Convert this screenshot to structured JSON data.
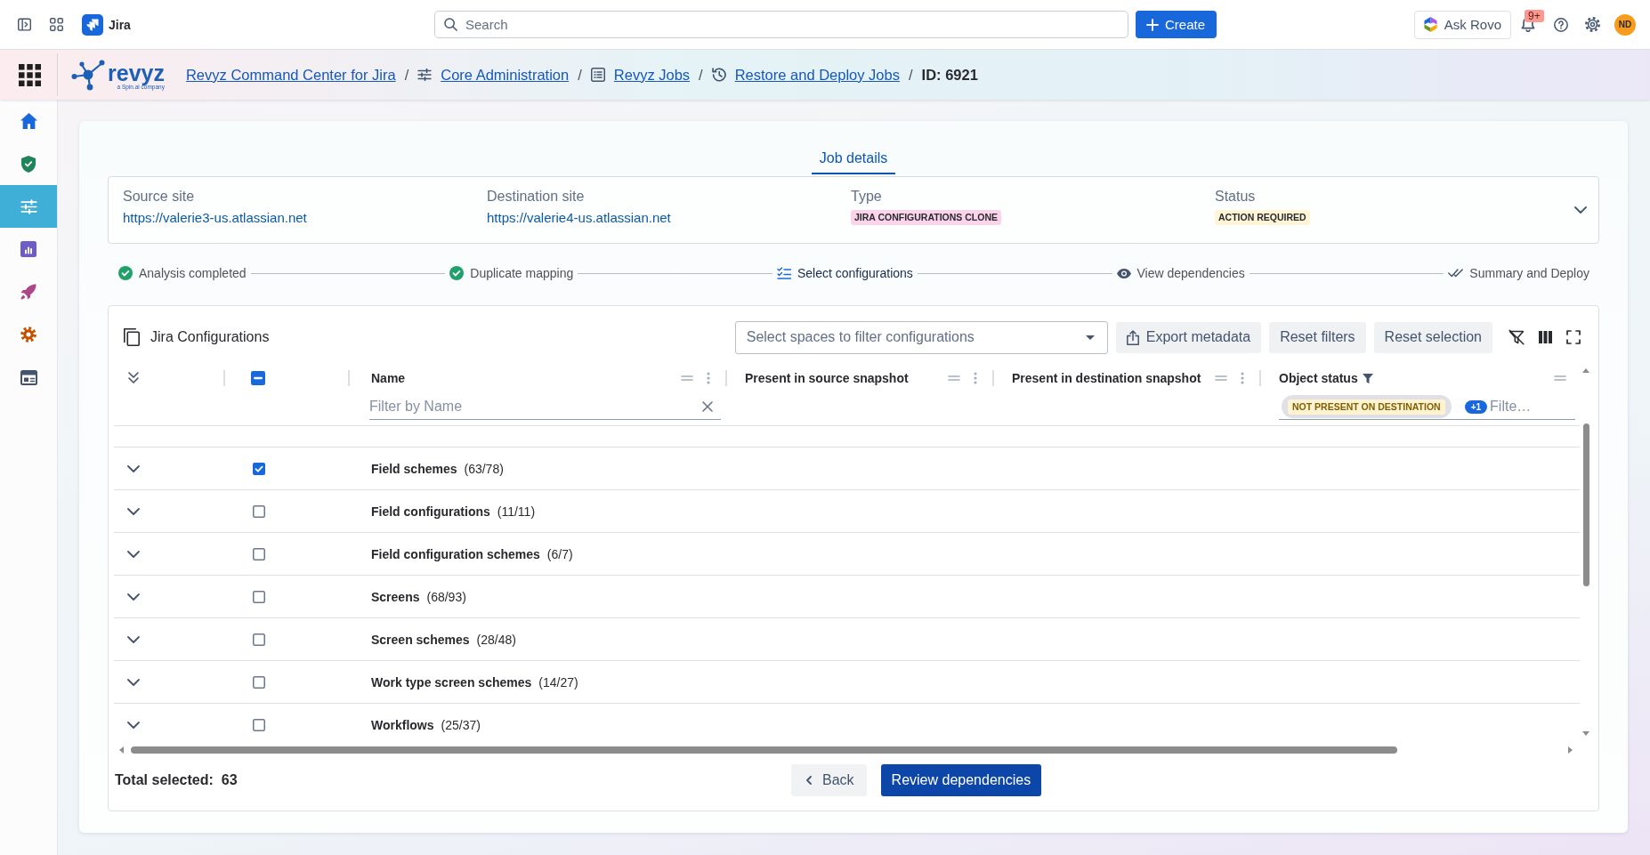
{
  "top_bar": {
    "product": "Jira",
    "search": {
      "placeholder": "Search"
    },
    "create_button": "Create",
    "rovo_button": "Ask Rovo",
    "notifications": {
      "badge": "9+"
    },
    "avatar": {
      "initials": "ND"
    }
  },
  "app_bar": {
    "logo": {
      "wordmark": "revyz",
      "tagline": "a Spin.ai company"
    },
    "separator": "/",
    "breadcrumbs": [
      {
        "label": "Revyz Command Center for Jira",
        "kind": "link"
      },
      {
        "label": "Core Administration",
        "kind": "link"
      },
      {
        "label": "Revyz Jobs",
        "kind": "link"
      },
      {
        "label": "Restore and Deploy Jobs",
        "kind": "link"
      },
      {
        "label": "ID: 6921",
        "kind": "current"
      }
    ]
  },
  "sidebar": {
    "items": [
      {
        "selected": false
      },
      {
        "selected": false
      },
      {
        "selected": true
      },
      {
        "selected": false
      },
      {
        "selected": false
      },
      {
        "selected": false
      },
      {
        "selected": false
      }
    ]
  },
  "job": {
    "tabs": [
      {
        "label": "Job details",
        "selected": true
      }
    ],
    "summary": {
      "expanded": false,
      "fields": [
        {
          "label": "Source site",
          "value": "https://valerie3-us.atlassian.net",
          "kind": "link"
        },
        {
          "label": "Destination site",
          "value": "https://valerie4-us.atlassian.net",
          "kind": "link"
        },
        {
          "label": "Type",
          "value": "JIRA CONFIGURATIONS CLONE",
          "kind": "tag",
          "color": "#fbd3ea"
        },
        {
          "label": "Status",
          "value": "ACTION REQUIRED",
          "kind": "tag",
          "color": "#fff4d6"
        }
      ]
    }
  },
  "steps": [
    {
      "label": "Analysis completed",
      "completed": true,
      "selected": false
    },
    {
      "label": "Duplicate mapping",
      "completed": true,
      "selected": false
    },
    {
      "label": "Select configurations",
      "completed": false,
      "selected": true
    },
    {
      "label": "View dependencies",
      "completed": false,
      "selected": false
    },
    {
      "label": "Summary and Deploy",
      "completed": false,
      "selected": false
    }
  ],
  "configurations": {
    "title": "Jira Configurations",
    "space_filter": {
      "placeholder": "Select spaces to filter configurations"
    },
    "actions": [
      {
        "label": "Export metadata",
        "kind": "export"
      },
      {
        "label": "Reset filters",
        "kind": "plain"
      },
      {
        "label": "Reset selection",
        "kind": "plain"
      }
    ],
    "table": {
      "select_all": {
        "checked": false,
        "indeterminate": true
      },
      "columns": [
        {
          "label": "Name",
          "filtered": false,
          "filter": {
            "placeholder": "Filter by Name",
            "clearable": true
          }
        },
        {
          "label": "Present in source snapshot",
          "filtered": false
        },
        {
          "label": "Present in destination snapshot",
          "filtered": false
        },
        {
          "label": "Object status",
          "filtered": true,
          "filter": {
            "chips": [
              "NOT PRESENT ON DESTINATION"
            ],
            "more": "+1",
            "placeholder": "Filte…",
            "clearable": false
          }
        }
      ],
      "rows": [
        {
          "name": "Field schemes",
          "count": "(63/78)",
          "checked": true,
          "expanded": false
        },
        {
          "name": "Field configurations",
          "count": "(11/11)",
          "checked": false,
          "expanded": false
        },
        {
          "name": "Field configuration schemes",
          "count": "(6/7)",
          "checked": false,
          "expanded": false
        },
        {
          "name": "Screens",
          "count": "(68/93)",
          "checked": false,
          "expanded": false
        },
        {
          "name": "Screen schemes",
          "count": "(28/48)",
          "checked": false,
          "expanded": false
        },
        {
          "name": "Work type screen schemes",
          "count": "(14/27)",
          "checked": false,
          "expanded": false
        },
        {
          "name": "Workflows",
          "count": "(25/37)",
          "checked": false,
          "expanded": false
        }
      ]
    }
  },
  "footer": {
    "total_label": "Total selected:",
    "total_value": "63",
    "back_button": "Back",
    "next_button": "Review dependencies"
  }
}
